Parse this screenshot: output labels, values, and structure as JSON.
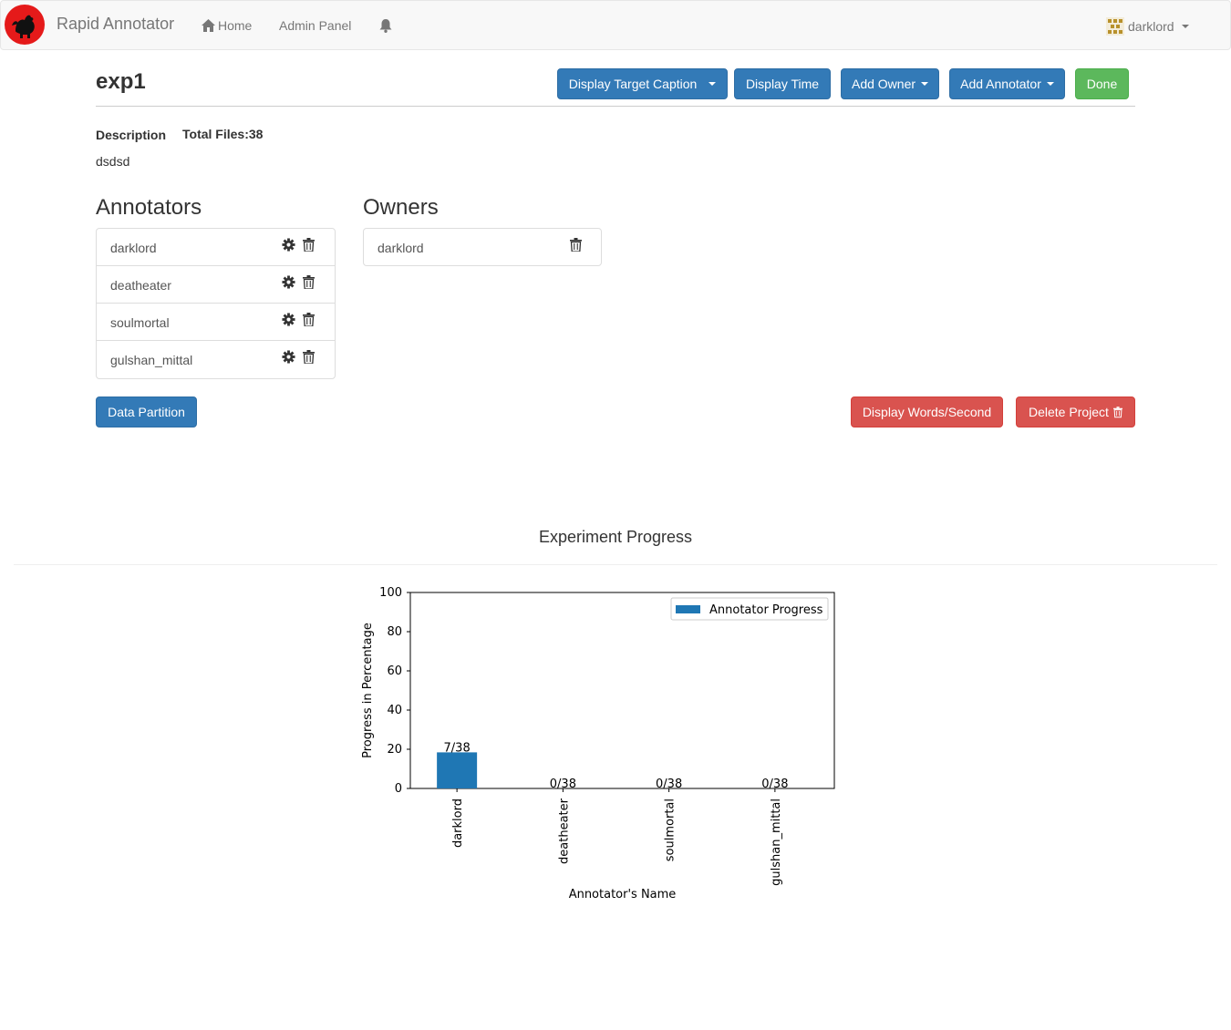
{
  "navbar": {
    "brand": "Rapid Annotator",
    "home": "Home",
    "admin_panel": "Admin Panel",
    "user": "darklord",
    "icons": [
      "rooster-logo",
      "home-icon",
      "bell-icon",
      "user-avatar-icon"
    ]
  },
  "project": {
    "title": "exp1",
    "description_label": "Description",
    "total_files_label": "Total Files:",
    "total_files": "38",
    "description": "dsdsd"
  },
  "toolbar": {
    "display_target_caption": "Display Target Caption",
    "display_time": "Display Time",
    "add_owner": "Add Owner",
    "add_annotator": "Add Annotator",
    "done": "Done"
  },
  "annotators": {
    "title": "Annotators",
    "items": [
      {
        "name": "darklord"
      },
      {
        "name": "deatheater"
      },
      {
        "name": "soulmortal"
      },
      {
        "name": "gulshan_mittal"
      }
    ]
  },
  "owners": {
    "title": "Owners",
    "items": [
      {
        "name": "darklord"
      }
    ]
  },
  "actions": {
    "data_partition": "Data Partition",
    "display_words_second": "Display Words/Second",
    "delete_project": "Delete Project"
  },
  "colors": {
    "primary": "#337ab7",
    "success": "#5cb85c",
    "danger": "#d9534f",
    "bar": "#1f77b4"
  },
  "chart_section_title": "Experiment Progress",
  "chart_data": {
    "type": "bar",
    "categories": [
      "darklord",
      "deatheater",
      "soulmortal",
      "gulshan_mittal"
    ],
    "series": [
      {
        "name": "Annotator Progress",
        "values": [
          18.42,
          0,
          0,
          0
        ]
      }
    ],
    "bar_labels": [
      "7/38",
      "0/38",
      "0/38",
      "0/38"
    ],
    "xlabel": "Annotator's Name",
    "ylabel": "Progress in Percentage",
    "ylim": [
      0,
      100
    ],
    "yticks": [
      0,
      20,
      40,
      60,
      80,
      100
    ],
    "legend": "top-right",
    "grid": false
  }
}
